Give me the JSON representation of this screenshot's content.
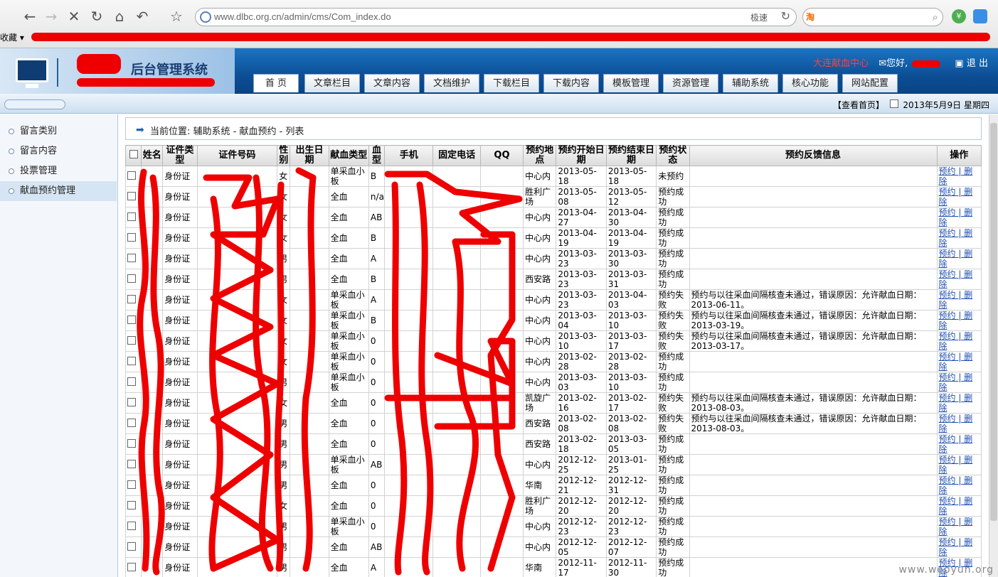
{
  "browser": {
    "url": "www.dlbc.org.cn/admin/cms/Com_index.do",
    "fast_label": "极速",
    "bookmark_label": "收藏",
    "search_engine": "淘"
  },
  "header": {
    "system_title": "后台管理系统",
    "link_center": "大连献血中心",
    "greeting": "您好,",
    "logout": "退 出",
    "nav": [
      "首 页",
      "文章栏目",
      "文章内容",
      "文档维护",
      "下载栏目",
      "下载内容",
      "模板管理",
      "资源管理",
      "辅助系统",
      "核心功能",
      "网站配置"
    ]
  },
  "subbar": {
    "view_home": "【查看首页】",
    "date": "2013年5月9日 星期四"
  },
  "sidebar": {
    "items": [
      "留言类别",
      "留言内容",
      "投票管理",
      "献血预约管理"
    ]
  },
  "breadcrumb": "当前位置: 辅助系统 - 献血预约 - 列表",
  "table": {
    "headers": [
      "",
      "姓名",
      "证件类型",
      "证件号码",
      "性别",
      "出生日期",
      "献血类型",
      "血型",
      "手机",
      "固定电话",
      "QQ",
      "预约地点",
      "预约开始日期",
      "预约结束日期",
      "预约状态",
      "预约反馈信息",
      "操作"
    ],
    "rows": [
      [
        "",
        "",
        "身份证",
        "",
        "女",
        "",
        "单采血小板",
        "B",
        "",
        "",
        "",
        "中心内",
        "2013-05-18",
        "2013-05-18",
        "未预约",
        "",
        "预约 | 删除"
      ],
      [
        "",
        "",
        "身份证",
        "",
        "女",
        "",
        "全血",
        "n/a",
        "",
        "",
        "",
        "胜利广场",
        "2013-05-08",
        "2013-05-12",
        "预约成功",
        "",
        "预约 | 删除"
      ],
      [
        "",
        "",
        "身份证",
        "",
        "女",
        "",
        "全血",
        "AB",
        "",
        "",
        "",
        "中心内",
        "2013-04-27",
        "2013-04-30",
        "预约成功",
        "",
        "预约 | 删除"
      ],
      [
        "",
        "",
        "身份证",
        "",
        "女",
        "",
        "全血",
        "B",
        "",
        "",
        "",
        "中心内",
        "2013-04-19",
        "2013-04-19",
        "预约成功",
        "",
        "预约 | 删除"
      ],
      [
        "",
        "",
        "身份证",
        "",
        "男",
        "",
        "全血",
        "A",
        "",
        "",
        "",
        "中心内",
        "2013-03-23",
        "2013-03-30",
        "预约成功",
        "",
        "预约 | 删除"
      ],
      [
        "",
        "",
        "身份证",
        "",
        "男",
        "",
        "全血",
        "B",
        "",
        "",
        "",
        "西安路",
        "2013-03-23",
        "2013-03-31",
        "预约成功",
        "",
        "预约 | 删除"
      ],
      [
        "",
        "",
        "身份证",
        "",
        "女",
        "",
        "单采血小板",
        "A",
        "",
        "",
        "",
        "中心内",
        "2013-03-23",
        "2013-04-03",
        "预约失败",
        "预约与以往采血间隔核查未通过，错误原因：允许献血日期：2013-06-11。",
        "预约 | 删除"
      ],
      [
        "",
        "",
        "身份证",
        "",
        "女",
        "",
        "单采血小板",
        "B",
        "",
        "",
        "",
        "中心内",
        "2013-03-04",
        "2013-03-10",
        "预约失败",
        "预约与以往采血间隔核查未通过，错误原因：允许献血日期：2013-03-19。",
        "预约 | 删除"
      ],
      [
        "",
        "",
        "身份证",
        "",
        "女",
        "",
        "单采血小板",
        "0",
        "",
        "",
        "",
        "中心内",
        "2013-03-10",
        "2013-03-17",
        "预约失败",
        "预约与以往采血间隔核查未通过，错误原因：允许献血日期：2013-03-17。",
        "预约 | 删除"
      ],
      [
        "",
        "",
        "身份证",
        "",
        "女",
        "",
        "单采血小板",
        "0",
        "",
        "",
        "",
        "中心内",
        "2013-02-28",
        "2013-02-28",
        "预约成功",
        "",
        "预约 | 删除"
      ],
      [
        "",
        "",
        "身份证",
        "",
        "男",
        "",
        "单采血小板",
        "0",
        "",
        "",
        "",
        "中心内",
        "2013-03-03",
        "2013-03-10",
        "预约成功",
        "",
        "预约 | 删除"
      ],
      [
        "",
        "",
        "身份证",
        "",
        "女",
        "",
        "全血",
        "0",
        "",
        "",
        "",
        "凯旋广场",
        "2013-02-16",
        "2013-02-17",
        "预约失败",
        "预约与以往采血间隔核查未通过，错误原因：允许献血日期：2013-08-03。",
        "预约 | 删除"
      ],
      [
        "",
        "",
        "身份证",
        "",
        "男",
        "",
        "全血",
        "0",
        "",
        "",
        "",
        "西安路",
        "2013-02-08",
        "2013-02-08",
        "预约失败",
        "预约与以往采血间隔核查未通过，错误原因：允许献血日期：2013-08-03。",
        "预约 | 删除"
      ],
      [
        "",
        "",
        "身份证",
        "",
        "男",
        "",
        "全血",
        "0",
        "",
        "",
        "",
        "西安路",
        "2013-02-18",
        "2013-03-05",
        "预约成功",
        "",
        "预约 | 删除"
      ],
      [
        "",
        "",
        "身份证",
        "",
        "男",
        "",
        "单采血小板",
        "AB",
        "",
        "",
        "",
        "中心内",
        "2012-12-25",
        "2013-01-25",
        "预约成功",
        "",
        "预约 | 删除"
      ],
      [
        "",
        "",
        "身份证",
        "",
        "男",
        "",
        "全血",
        "0",
        "",
        "",
        "",
        "华南",
        "2012-12-21",
        "2012-12-31",
        "预约成功",
        "",
        "预约 | 删除"
      ],
      [
        "",
        "",
        "身份证",
        "",
        "女",
        "",
        "全血",
        "0",
        "",
        "",
        "",
        "胜利广场",
        "2012-12-20",
        "2012-12-20",
        "预约成功",
        "",
        "预约 | 删除"
      ],
      [
        "",
        "",
        "身份证",
        "",
        "男",
        "",
        "单采血小板",
        "0",
        "",
        "",
        "",
        "中心内",
        "2012-12-23",
        "2012-12-23",
        "预约成功",
        "",
        "预约 | 删除"
      ],
      [
        "",
        "",
        "身份证",
        "",
        "男",
        "",
        "全血",
        "AB",
        "",
        "",
        "",
        "中心内",
        "2012-12-05",
        "2012-12-07",
        "预约成功",
        "",
        "预约 | 删除"
      ],
      [
        "",
        "",
        "身份证",
        "",
        "男",
        "",
        "全血",
        "A",
        "",
        "",
        "",
        "华南",
        "2012-11-17",
        "2012-11-30",
        "预约成功",
        "",
        "预约 | 删除"
      ]
    ]
  },
  "watermark": "www.wooyun.org",
  "colors": {
    "header_blue": "#0d4e96",
    "redaction_red": "#e00000",
    "link_blue": "#1f4fb0"
  }
}
